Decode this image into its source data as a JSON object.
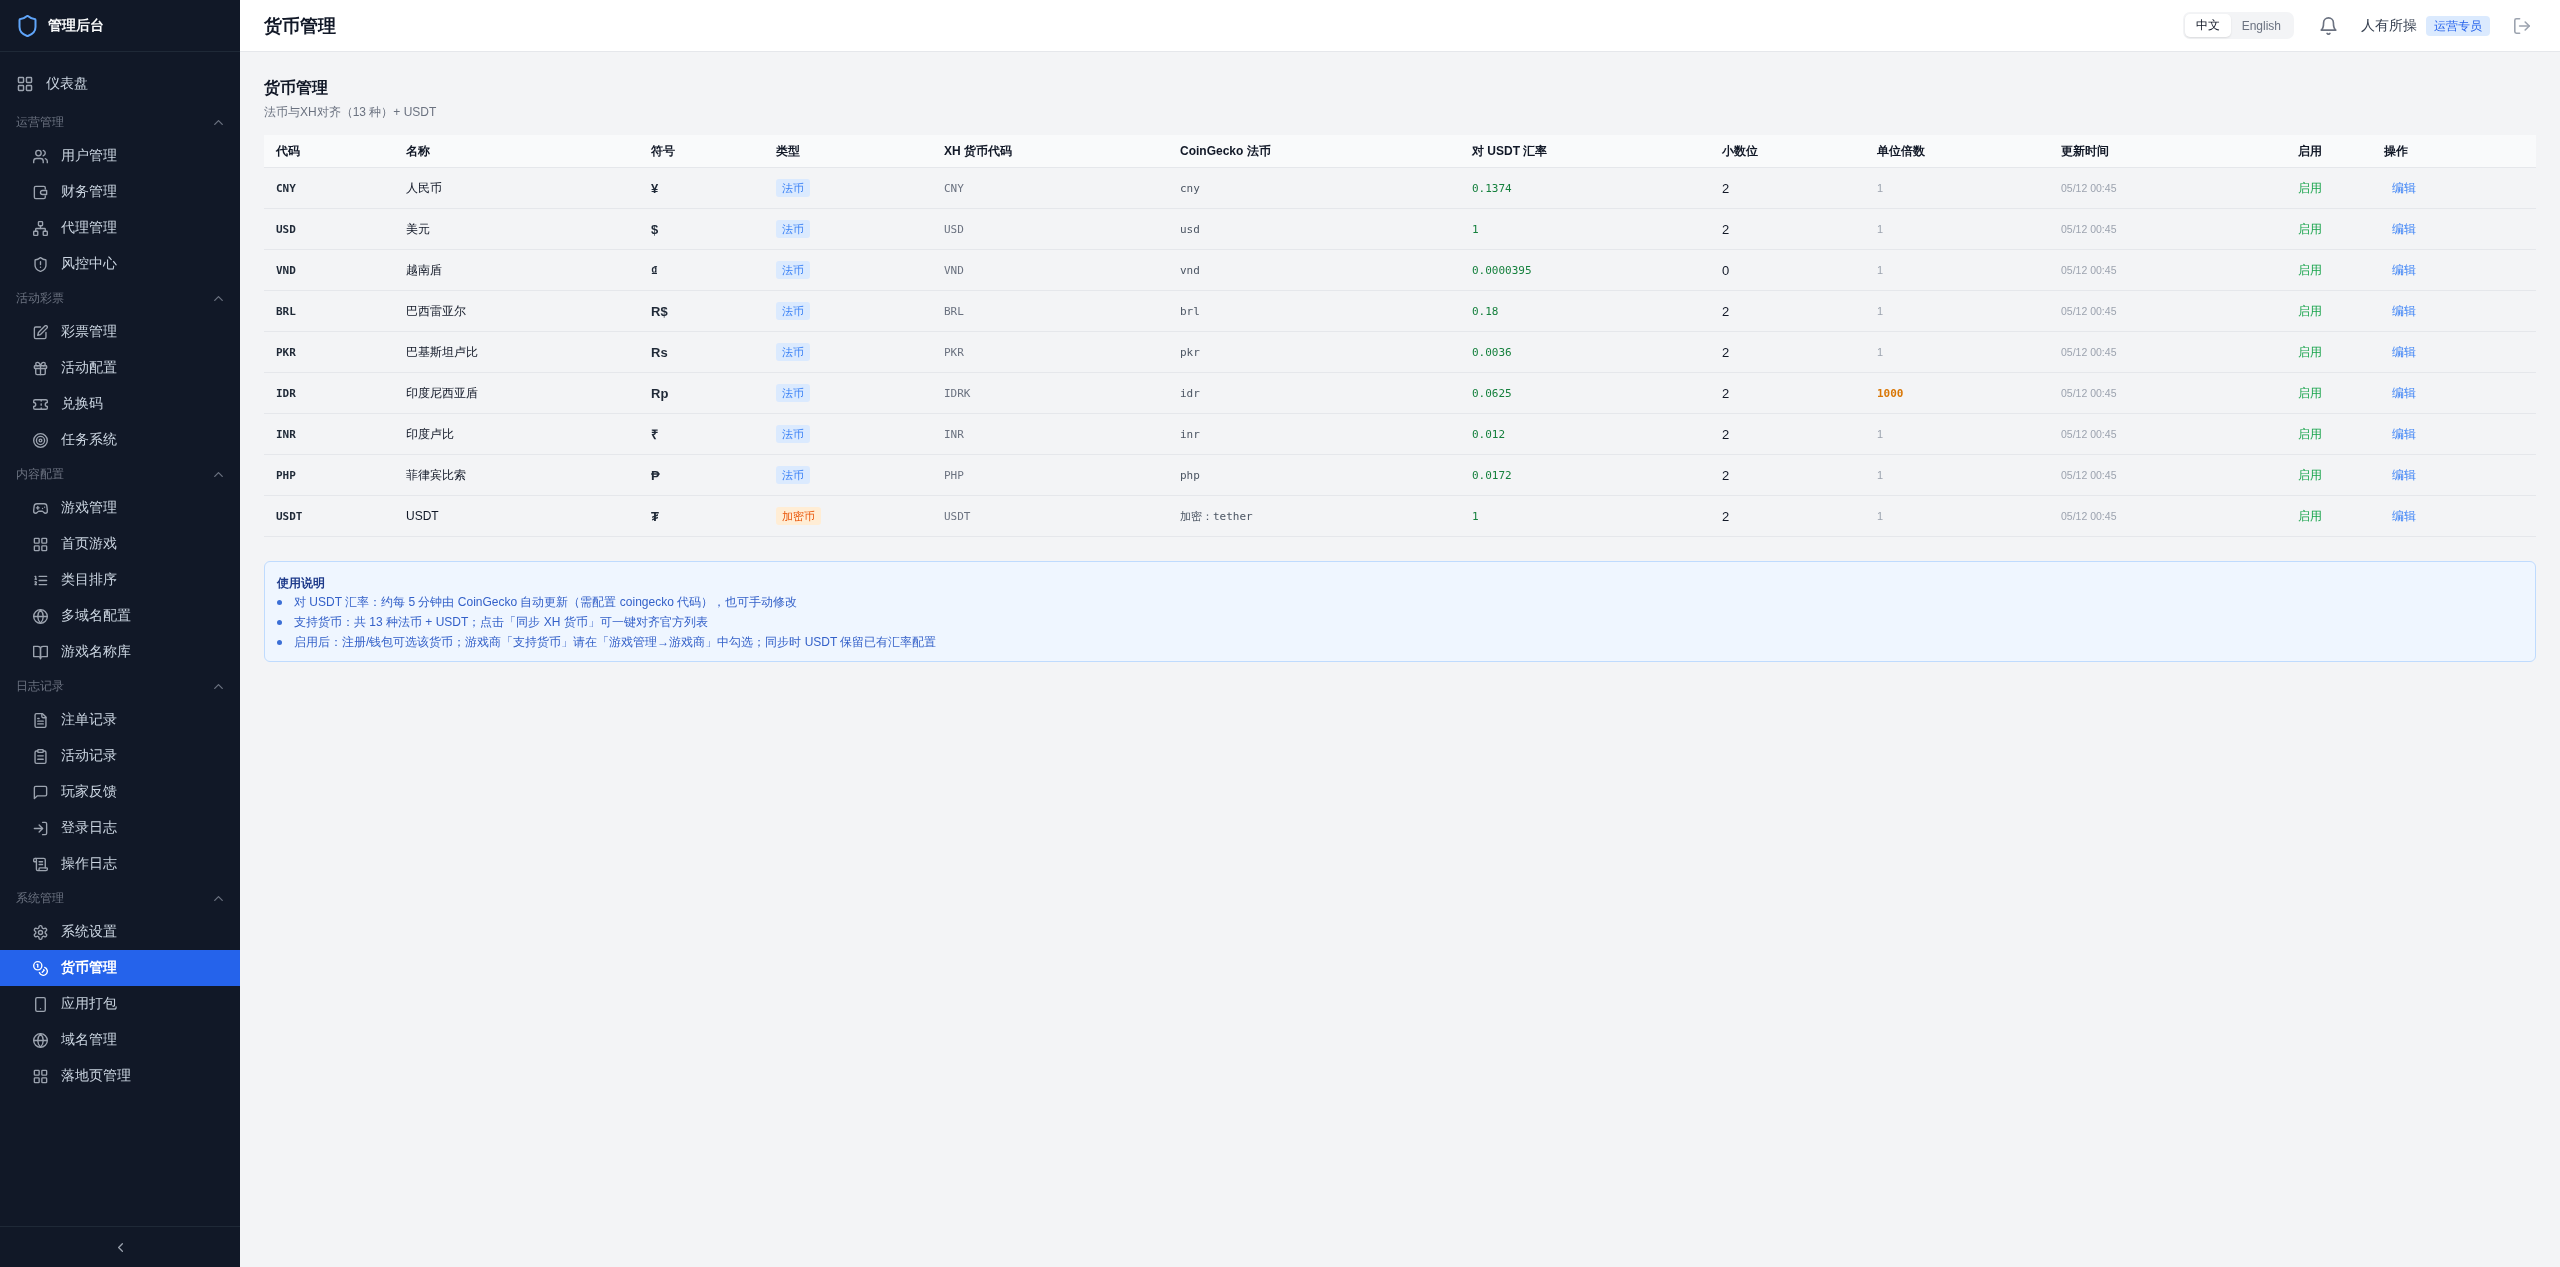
{
  "sidebar": {
    "brand": "管理后台",
    "items": [
      {
        "label": "仪表盘",
        "selected": false
      }
    ],
    "groups": [
      {
        "heading": "运营管理",
        "expanded": true,
        "items": [
          {
            "label": "用户管理",
            "selected": false
          },
          {
            "label": "财务管理",
            "selected": false
          },
          {
            "label": "代理管理",
            "selected": false
          },
          {
            "label": "风控中心",
            "selected": false
          }
        ]
      },
      {
        "heading": "活动彩票",
        "expanded": true,
        "items": [
          {
            "label": "彩票管理",
            "selected": false
          },
          {
            "label": "活动配置",
            "selected": false
          },
          {
            "label": "兑换码",
            "selected": false
          },
          {
            "label": "任务系统",
            "selected": false
          }
        ]
      },
      {
        "heading": "内容配置",
        "expanded": true,
        "items": [
          {
            "label": "游戏管理",
            "selected": false
          },
          {
            "label": "首页游戏",
            "selected": false
          },
          {
            "label": "类目排序",
            "selected": false
          },
          {
            "label": "多域名配置",
            "selected": false
          },
          {
            "label": "游戏名称库",
            "selected": false
          }
        ]
      },
      {
        "heading": "日志记录",
        "expanded": true,
        "items": [
          {
            "label": "注单记录",
            "selected": false
          },
          {
            "label": "活动记录",
            "selected": false
          },
          {
            "label": "玩家反馈",
            "selected": false
          },
          {
            "label": "登录日志",
            "selected": false
          },
          {
            "label": "操作日志",
            "selected": false
          }
        ]
      },
      {
        "heading": "系统管理",
        "expanded": true,
        "items": [
          {
            "label": "系统设置",
            "selected": false
          },
          {
            "label": "货币管理",
            "selected": true
          },
          {
            "label": "应用打包",
            "selected": false
          },
          {
            "label": "域名管理",
            "selected": false
          },
          {
            "label": "落地页管理",
            "selected": false
          }
        ]
      }
    ]
  },
  "header": {
    "title": "货币管理",
    "languages": [
      {
        "label": "中文",
        "selected": true
      },
      {
        "label": "English",
        "selected": false
      }
    ],
    "user": "人有所操",
    "role": "运营专员"
  },
  "page": {
    "title": "货币管理",
    "subtitle": "法币与XH对齐（13 种）+ USDT"
  },
  "table": {
    "columns": [
      "代码",
      "名称",
      "符号",
      "类型",
      "XH 货币代码",
      "CoinGecko 法币",
      "对 USDT 汇率",
      "小数位",
      "单位倍数",
      "更新时间",
      "启用",
      "操作"
    ],
    "rows": [
      {
        "code": "CNY",
        "name": "人民币",
        "symbol": "¥",
        "type": "法币",
        "crypto": false,
        "xh_code": "CNY",
        "coingecko": "cny",
        "rate": "0.1374",
        "decimals": "2",
        "multiplier": "1",
        "multiplier_custom": false,
        "updated": "05/12 00:45",
        "status": "启用",
        "enabled": true,
        "action": "编辑"
      },
      {
        "code": "USD",
        "name": "美元",
        "symbol": "$",
        "type": "法币",
        "crypto": false,
        "xh_code": "USD",
        "coingecko": "usd",
        "rate": "1",
        "decimals": "2",
        "multiplier": "1",
        "multiplier_custom": false,
        "updated": "05/12 00:45",
        "status": "启用",
        "enabled": true,
        "action": "编辑"
      },
      {
        "code": "VND",
        "name": "越南盾",
        "symbol": "₫",
        "type": "法币",
        "crypto": false,
        "xh_code": "VND",
        "coingecko": "vnd",
        "rate": "0.0000395",
        "decimals": "0",
        "multiplier": "1",
        "multiplier_custom": false,
        "updated": "05/12 00:45",
        "status": "启用",
        "enabled": true,
        "action": "编辑"
      },
      {
        "code": "BRL",
        "name": "巴西雷亚尔",
        "symbol": "R$",
        "type": "法币",
        "crypto": false,
        "xh_code": "BRL",
        "coingecko": "brl",
        "rate": "0.18",
        "decimals": "2",
        "multiplier": "1",
        "multiplier_custom": false,
        "updated": "05/12 00:45",
        "status": "启用",
        "enabled": true,
        "action": "编辑"
      },
      {
        "code": "PKR",
        "name": "巴基斯坦卢比",
        "symbol": "Rs",
        "type": "法币",
        "crypto": false,
        "xh_code": "PKR",
        "coingecko": "pkr",
        "rate": "0.0036",
        "decimals": "2",
        "multiplier": "1",
        "multiplier_custom": false,
        "updated": "05/12 00:45",
        "status": "启用",
        "enabled": true,
        "action": "编辑"
      },
      {
        "code": "IDR",
        "name": "印度尼西亚盾",
        "symbol": "Rp",
        "type": "法币",
        "crypto": false,
        "xh_code": "IDRK",
        "coingecko": "idr",
        "rate": "0.0625",
        "decimals": "2",
        "multiplier": "1000",
        "multiplier_custom": true,
        "updated": "05/12 00:45",
        "status": "启用",
        "enabled": true,
        "action": "编辑"
      },
      {
        "code": "INR",
        "name": "印度卢比",
        "symbol": "₹",
        "type": "法币",
        "crypto": false,
        "xh_code": "INR",
        "coingecko": "inr",
        "rate": "0.012",
        "decimals": "2",
        "multiplier": "1",
        "multiplier_custom": false,
        "updated": "05/12 00:45",
        "status": "启用",
        "enabled": true,
        "action": "编辑"
      },
      {
        "code": "PHP",
        "name": "菲律宾比索",
        "symbol": "₱",
        "type": "法币",
        "crypto": false,
        "xh_code": "PHP",
        "coingecko": "php",
        "rate": "0.0172",
        "decimals": "2",
        "multiplier": "1",
        "multiplier_custom": false,
        "updated": "05/12 00:45",
        "status": "启用",
        "enabled": true,
        "action": "编辑"
      },
      {
        "code": "USDT",
        "name": "USDT",
        "symbol": "₮",
        "type": "加密币",
        "crypto": true,
        "xh_code": "USDT",
        "coingecko": "加密：tether",
        "rate": "1",
        "decimals": "2",
        "multiplier": "1",
        "multiplier_custom": false,
        "updated": "05/12 00:45",
        "status": "启用",
        "enabled": true,
        "action": "编辑"
      }
    ]
  },
  "notes": {
    "title": "使用说明",
    "items": [
      "对 USDT 汇率：约每 5 分钟由 CoinGecko 自动更新（需配置 coingecko 代码），也可手动修改",
      "支持货币：共 13 种法币 + USDT；点击「同步 XH 货币」可一键对齐官方列表",
      "启用后：注册/钱包可选该货币；游戏商「支持货币」请在「游戏管理→游戏商」中勾选；同步时 USDT 保留已有汇率配置"
    ]
  }
}
